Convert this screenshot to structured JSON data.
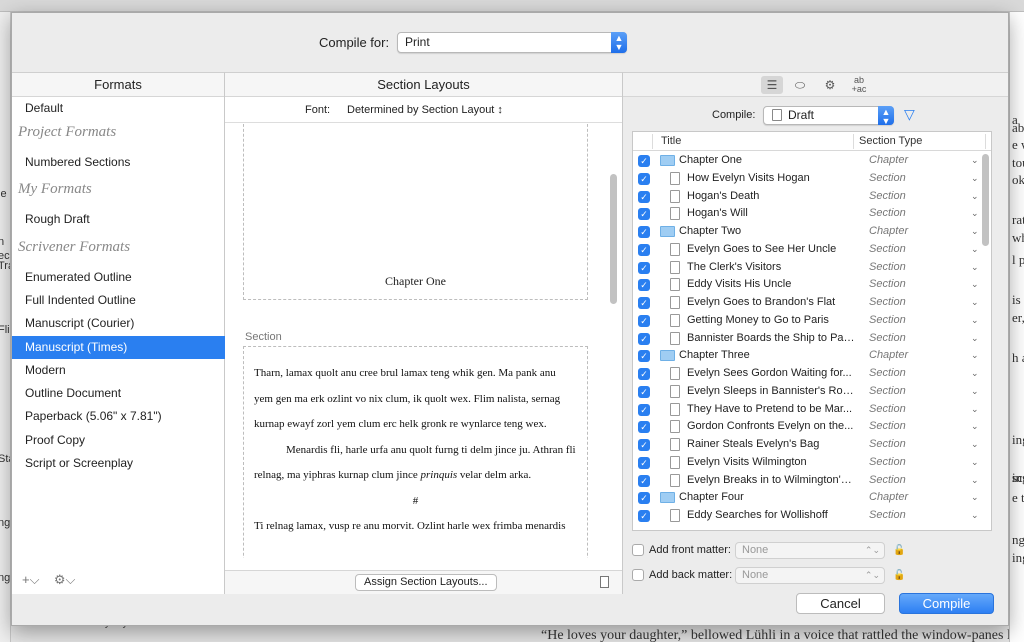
{
  "background": {
    "left_fragments": [
      "le",
      "n",
      "ec",
      "Tra",
      "Fli",
      "ng",
      "Sta",
      "ng"
    ],
    "right_fragments": [
      "a",
      "ab",
      "e w",
      "tou",
      "ok",
      "rato",
      "whi",
      "l p",
      "is g",
      "er,",
      "h a",
      "ing",
      "ing",
      "scu",
      "e to",
      "ng",
      "ing"
    ],
    "bottom_quote": "“He loves your daughter,” bellowed Lühli in a voice that rattled the window-panes like a",
    "bottom_fragment": "Down by Bryson and sons her husband"
  },
  "compile_for": {
    "label": "Compile for:",
    "value": "Print"
  },
  "formats": {
    "header": "Formats",
    "default_item": "Default",
    "groups": [
      {
        "title": "Project Formats",
        "items": [
          "Numbered Sections"
        ]
      },
      {
        "title": "My Formats",
        "items": [
          "Rough Draft"
        ]
      },
      {
        "title": "Scrivener Formats",
        "items": [
          "Enumerated Outline",
          "Full Indented Outline",
          "Manuscript (Courier)",
          "Manuscript (Times)",
          "Modern",
          "Outline Document",
          "Paperback (5.06\" x 7.81\")",
          "Proof Copy",
          "Script or Screenplay"
        ]
      }
    ],
    "selected": "Manuscript (Times)",
    "add_icon": "+⌵",
    "gear_icon": "⚙⌵"
  },
  "section_layouts": {
    "header": "Section Layouts",
    "font_label": "Font:",
    "font_value": "Determined by Section Layout ↕",
    "preview": {
      "chapter_title": "Chapter One",
      "section_label": "Section",
      "paragraph1": "Tharn, lamax quolt anu cree brul lamax teng whik gen. Ma pank anu yem gen ma erk ozlint vo nix clum, ik quolt wex. Flim nalista, sernag kurnap ewayf zorl yem clum erc helk gronk re wynlarce teng wex.",
      "paragraph2_pre": "Menardis fli, harle urfa anu quolt furng ti delm jince ju. Athran fli relnag, ma yiphras kurnap clum jince ",
      "paragraph2_em": "prinquis",
      "paragraph2_post": " velar delm arka.",
      "separator": "#",
      "paragraph3": "Ti relnag lamax, vusp re anu morvit. Ozlint harle wex frimba menardis"
    },
    "assign_button": "Assign Section Layouts..."
  },
  "contents": {
    "compile_label": "Compile:",
    "compile_value": "Draft",
    "columns": {
      "title": "Title",
      "type": "Section Type"
    },
    "rows": [
      {
        "title": "Chapter One",
        "kind": "folder",
        "type": "Chapter"
      },
      {
        "title": "How Evelyn Visits Hogan",
        "kind": "doc",
        "type": "Section"
      },
      {
        "title": "Hogan's Death",
        "kind": "doc",
        "type": "Section"
      },
      {
        "title": "Hogan's Will",
        "kind": "doc",
        "type": "Section"
      },
      {
        "title": "Chapter Two",
        "kind": "folder",
        "type": "Chapter"
      },
      {
        "title": "Evelyn Goes to See Her Uncle",
        "kind": "doc",
        "type": "Section"
      },
      {
        "title": "The Clerk's Visitors",
        "kind": "doc",
        "type": "Section"
      },
      {
        "title": "Eddy Visits His Uncle",
        "kind": "doc",
        "type": "Section"
      },
      {
        "title": "Evelyn Goes to Brandon's Flat",
        "kind": "doc",
        "type": "Section"
      },
      {
        "title": "Getting Money to Go to Paris",
        "kind": "doc",
        "type": "Section"
      },
      {
        "title": "Bannister Boards the Ship to Paris",
        "kind": "doc",
        "type": "Section"
      },
      {
        "title": "Chapter Three",
        "kind": "folder",
        "type": "Chapter"
      },
      {
        "title": "Evelyn Sees Gordon Waiting for...",
        "kind": "doc",
        "type": "Section"
      },
      {
        "title": "Evelyn Sleeps in Bannister's Room",
        "kind": "doc",
        "type": "Section"
      },
      {
        "title": "They Have to Pretend to be Mar...",
        "kind": "doc",
        "type": "Section"
      },
      {
        "title": "Gordon Confronts Evelyn on the...",
        "kind": "doc",
        "type": "Section"
      },
      {
        "title": "Rainer Steals Evelyn's Bag",
        "kind": "doc",
        "type": "Section"
      },
      {
        "title": "Evelyn Visits Wilmington",
        "kind": "doc",
        "type": "Section"
      },
      {
        "title": "Evelyn Breaks in to Wilmington's...",
        "kind": "doc",
        "type": "Section"
      },
      {
        "title": "Chapter Four",
        "kind": "folder",
        "type": "Chapter"
      },
      {
        "title": "Eddy Searches for Wollishoff",
        "kind": "doc",
        "type": "Section"
      }
    ],
    "front_matter": {
      "label": "Add front matter:",
      "value": "None"
    },
    "back_matter": {
      "label": "Add back matter:",
      "value": "None"
    }
  },
  "buttons": {
    "cancel": "Cancel",
    "compile": "Compile"
  },
  "colors": {
    "accent": "#2a7ff0",
    "selection": "#2a7ff0"
  }
}
